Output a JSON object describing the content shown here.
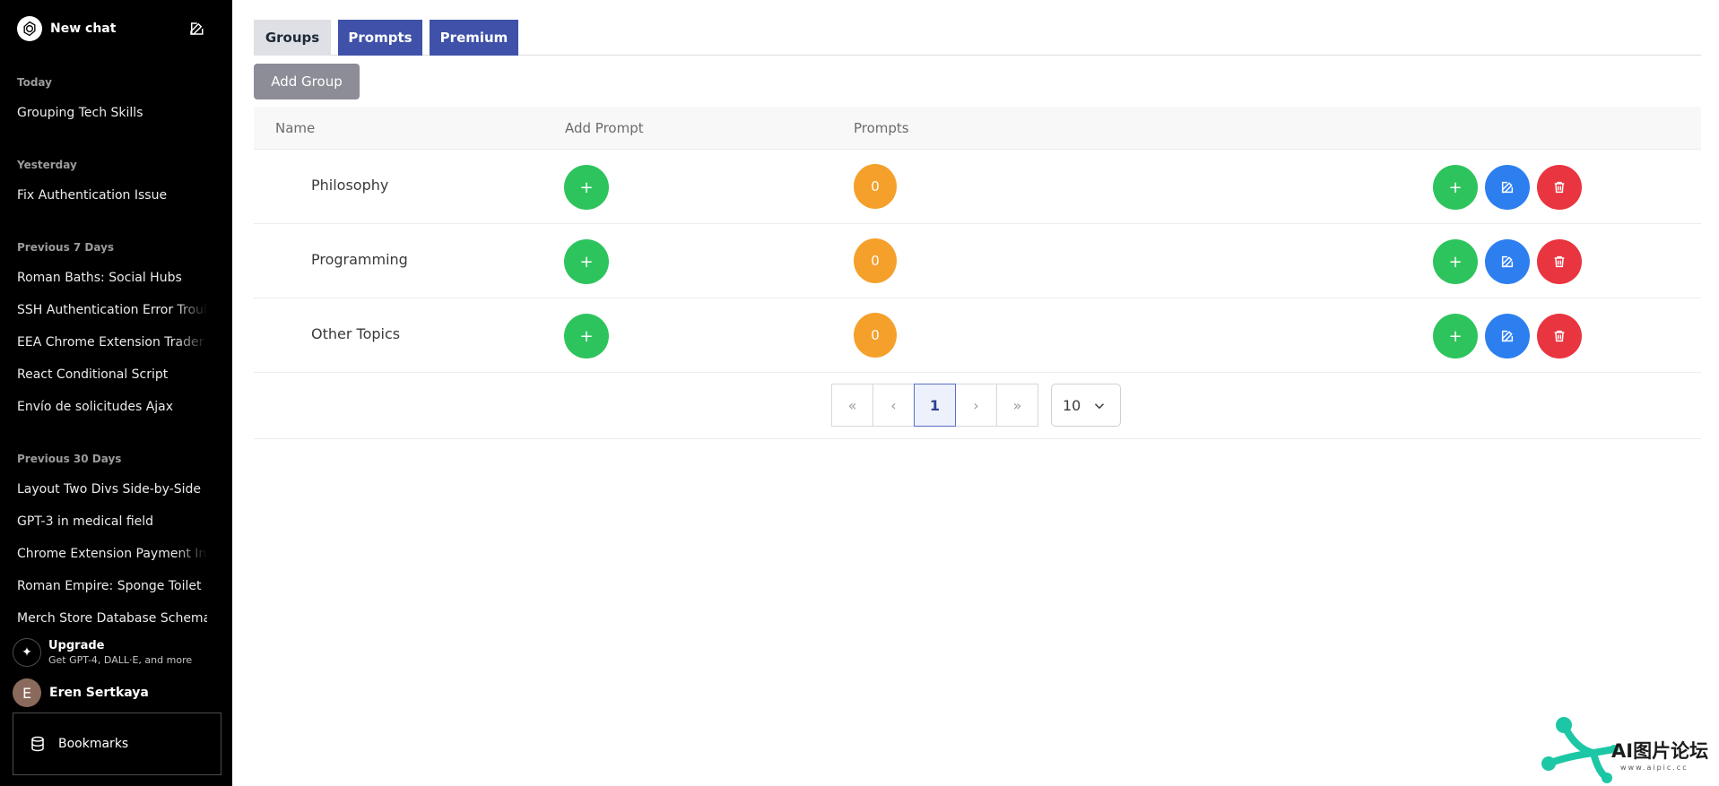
{
  "sidebar": {
    "new_chat": "New chat",
    "sections": [
      {
        "label": "Today",
        "items": [
          "Grouping Tech Skills"
        ]
      },
      {
        "label": "Yesterday",
        "items": [
          "Fix Authentication Issue"
        ]
      },
      {
        "label": "Previous 7 Days",
        "items": [
          "Roman Baths: Social Hubs",
          "SSH Authentication Error Troublesh",
          "EEA Chrome Extension Trader Cla",
          "React Conditional Script",
          "Envío de solicitudes Ajax"
        ]
      },
      {
        "label": "Previous 30 Days",
        "items": [
          "Layout Two Divs Side-by-Side",
          "GPT-3 in medical field",
          "Chrome Extension Payment Integ",
          "Roman Empire: Sponge Toilet",
          "Merch Store Database Schema"
        ]
      }
    ],
    "upgrade": {
      "title": "Upgrade",
      "subtitle": "Get GPT-4, DALL·E, and more"
    },
    "user": {
      "initial": "E",
      "name": "Eren Sertkaya"
    },
    "bookmarks_label": "Bookmarks"
  },
  "tabs": [
    {
      "label": "Groups",
      "active": true
    },
    {
      "label": "Prompts",
      "active": false
    },
    {
      "label": "Premium",
      "active": false
    }
  ],
  "add_group_label": "Add Group",
  "table": {
    "headers": {
      "name": "Name",
      "add_prompt": "Add Prompt",
      "prompts": "Prompts"
    },
    "rows": [
      {
        "name": "Philosophy",
        "add_label": "+",
        "prompt_count": "0"
      },
      {
        "name": "Programming",
        "add_label": "+",
        "prompt_count": "0"
      },
      {
        "name": "Other Topics",
        "add_label": "+",
        "prompt_count": "0"
      }
    ]
  },
  "pagination": {
    "current_page": "1",
    "page_size": "10"
  },
  "watermark": {
    "text": "AI图片论坛",
    "sub": "www.aipic.cc"
  },
  "colors": {
    "tab_active": "#dee0e6",
    "tab_inactive": "#3f51a8",
    "green": "#2ec45d",
    "orange": "#f5a02a",
    "blue": "#2d7ff0",
    "red": "#e8353f"
  }
}
